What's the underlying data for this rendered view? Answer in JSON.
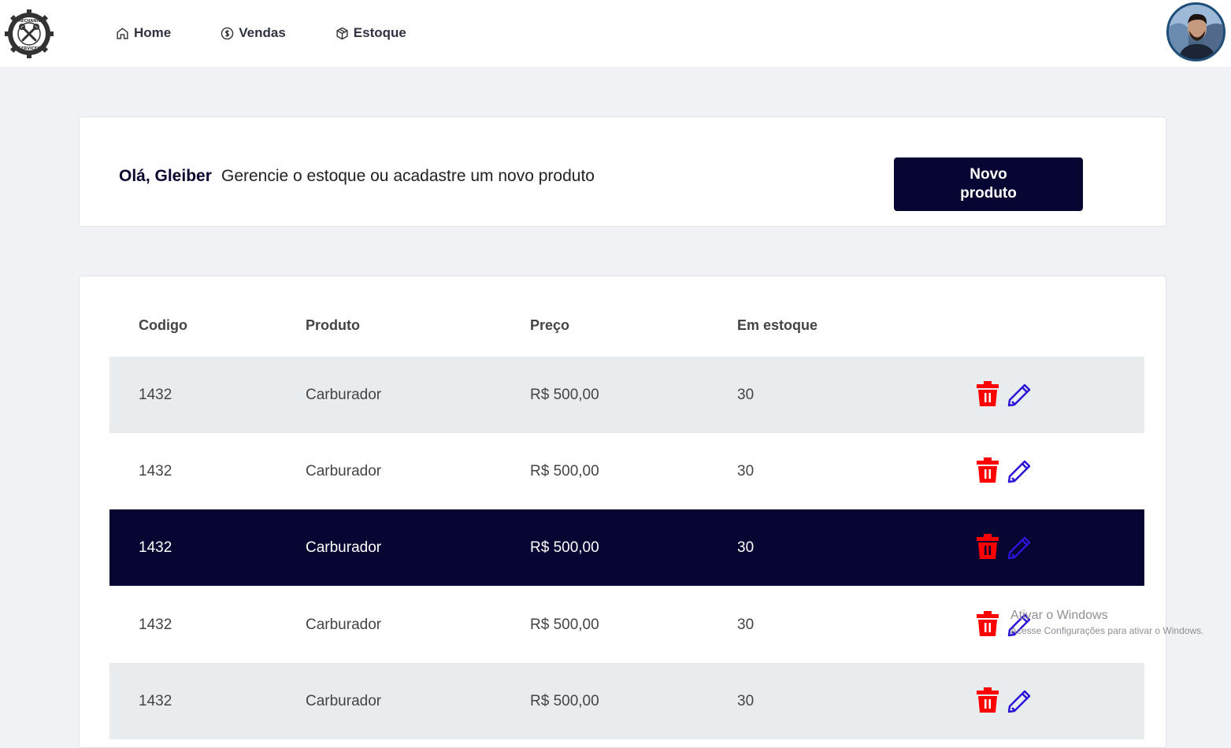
{
  "logo": {
    "icon": "mechanic-services-gear-logo",
    "text_top": "MECHANIC",
    "text_bottom": "SERVICES"
  },
  "nav": [
    {
      "label": "Home",
      "icon": "home-icon"
    },
    {
      "label": "Vendas",
      "icon": "dollar-circle-icon"
    },
    {
      "label": "Estoque",
      "icon": "box-icon"
    }
  ],
  "greeting": {
    "name": "Olá, Gleiber",
    "text": "Gerencie o estoque ou acadastre um novo produto",
    "button_label": "Novo produto"
  },
  "table": {
    "headers": [
      "Codigo",
      "Produto",
      "Preço",
      "Em estoque"
    ],
    "rows": [
      [
        "1432",
        "Carburador",
        "R$ 500,00",
        "30"
      ],
      [
        "1432",
        "Carburador",
        "R$ 500,00",
        "30"
      ],
      [
        "1432",
        "Carburador",
        "R$ 500,00",
        "30"
      ],
      [
        "1432",
        "Carburador",
        "R$ 500,00",
        "30"
      ],
      [
        "1432",
        "Carburador",
        "R$ 500,00",
        "30"
      ]
    ],
    "selected_row": 2
  },
  "colors": {
    "brand_dark": "#070531",
    "delete": "#ff0000",
    "edit": "#2b15d6",
    "row_alt": "#e9ecef"
  },
  "watermark": {
    "line1": "Ativar o Windows",
    "line2": "Acesse Configurações para ativar o Windows."
  }
}
